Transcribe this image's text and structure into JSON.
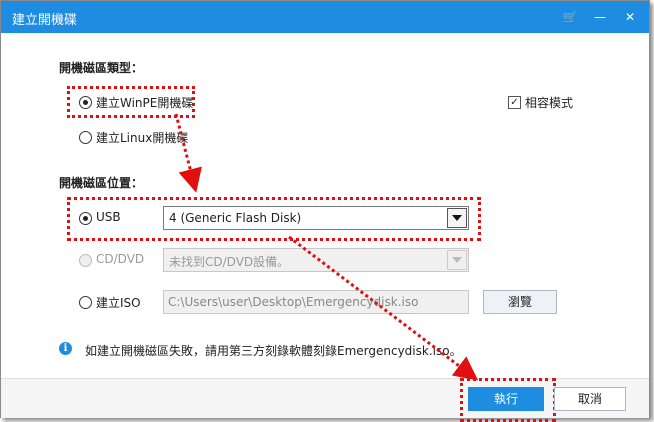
{
  "window": {
    "title": "建立開機碟"
  },
  "titlebar_icons": [
    "cart-icon",
    "minimize-icon",
    "close-icon"
  ],
  "titlebar_glyphs": {
    "cart": "🛒",
    "minimize": "—",
    "close": "✕"
  },
  "disk_type": {
    "label": "開機磁區類型：",
    "options": [
      {
        "label": "建立WinPE開機碟",
        "checked": true
      },
      {
        "label": "建立Linux開機碟",
        "checked": false
      }
    ],
    "compat": {
      "label": "相容模式",
      "checked": true
    }
  },
  "location": {
    "label": "開機磁區位置：",
    "usb": {
      "label": "USB",
      "checked": true,
      "value": "4 (Generic Flash Disk)"
    },
    "cd": {
      "label": "CD/DVD",
      "checked": false,
      "disabled": true,
      "value": "未找到CD/DVD設備。"
    },
    "iso": {
      "label": "建立ISO",
      "checked": false,
      "value": "C:\\Users\\user\\Desktop\\Emergencydisk.iso",
      "browse_label": "瀏覽"
    }
  },
  "info": {
    "icon": "info-icon",
    "glyph": "i",
    "text": "如建立開機磁區失敗，請用第三方刻錄軟體刻錄Emergencydisk.iso。"
  },
  "footer": {
    "execute_label": "執行",
    "cancel_label": "取消"
  },
  "colors": {
    "accent": "#1e8ce0",
    "highlight": "#e01010"
  }
}
